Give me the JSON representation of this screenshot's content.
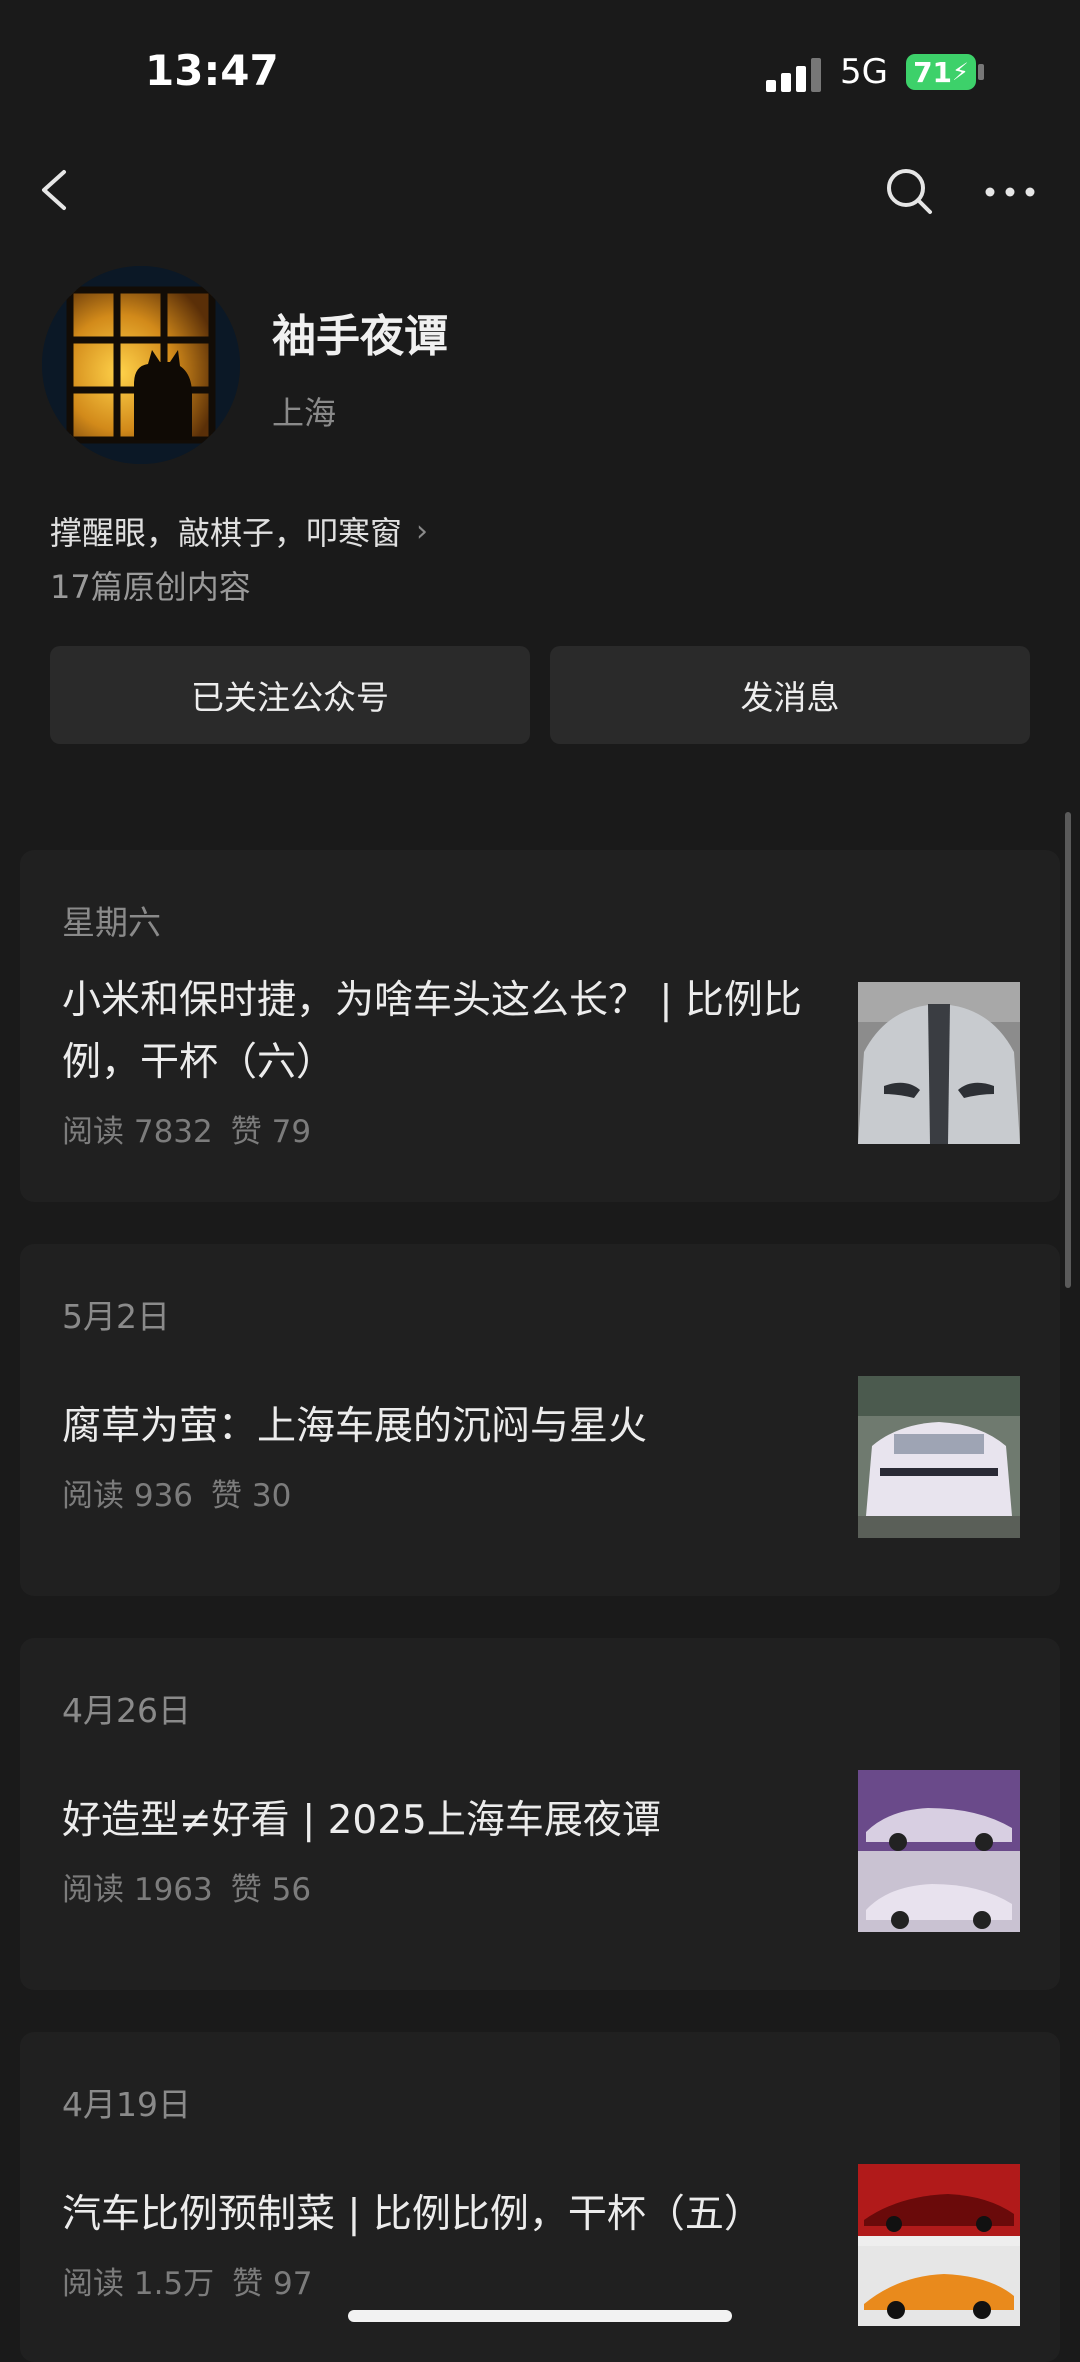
{
  "status": {
    "time": "13:47",
    "network": "5G",
    "battery": "71"
  },
  "profile": {
    "name": "袖手夜谭",
    "location": "上海",
    "bio": "撑醒眼，敲棋子，叩寒窗",
    "article_count": "17篇原创内容"
  },
  "actions": {
    "follow_label": "已关注公众号",
    "message_label": "发消息"
  },
  "articles": [
    {
      "date": "星期六",
      "title": "小米和保时捷，为啥车头这么长？ | 比例比例，干杯（六）",
      "reads": "阅读 7832",
      "likes": "赞 79"
    },
    {
      "date": "5月2日",
      "title": "腐草为萤：上海车展的沉闷与星火",
      "reads": "阅读 936",
      "likes": "赞 30"
    },
    {
      "date": "4月26日",
      "title": "好造型≠好看 | 2025上海车展夜谭",
      "reads": "阅读 1963",
      "likes": "赞 56"
    },
    {
      "date": "4月19日",
      "title": "汽车比例预制菜 | 比例比例，干杯（五）",
      "reads": "阅读 1.5万",
      "likes": "赞 97"
    }
  ],
  "icons": {
    "back": "chevron-left-icon",
    "search": "search-icon",
    "more": "more-dots-icon"
  }
}
